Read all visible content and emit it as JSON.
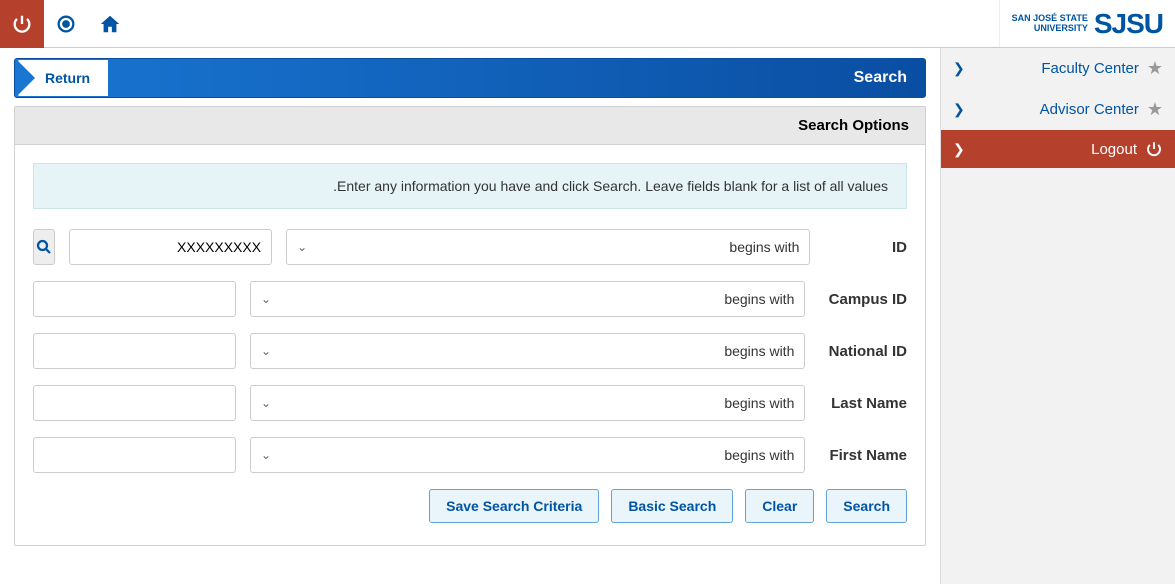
{
  "header": {
    "logo_main": "SJSU",
    "logo_sub1": "SAN JOSÉ STATE",
    "logo_sub2": "UNIVERSITY"
  },
  "sidebar": {
    "items": [
      {
        "label": "Faculty Center"
      },
      {
        "label": "Advisor Center"
      }
    ],
    "logout_label": "Logout"
  },
  "page": {
    "title": "Search",
    "return_label": "Return",
    "section_title": "Search Options",
    "info_text": "Enter any information you have and click Search. Leave fields blank for a list of all values."
  },
  "fields": [
    {
      "label": "ID",
      "op": "begins with",
      "value": "XXXXXXXXX",
      "lookup": true
    },
    {
      "label": "Campus ID",
      "op": "begins with",
      "value": "",
      "lookup": false
    },
    {
      "label": "National ID",
      "op": "begins with",
      "value": "",
      "lookup": false
    },
    {
      "label": "Last Name",
      "op": "begins with",
      "value": "",
      "lookup": false
    },
    {
      "label": "First Name",
      "op": "begins with",
      "value": "",
      "lookup": false
    }
  ],
  "buttons": {
    "search": "Search",
    "clear": "Clear",
    "basic": "Basic Search",
    "save": "Save Search Criteria"
  }
}
